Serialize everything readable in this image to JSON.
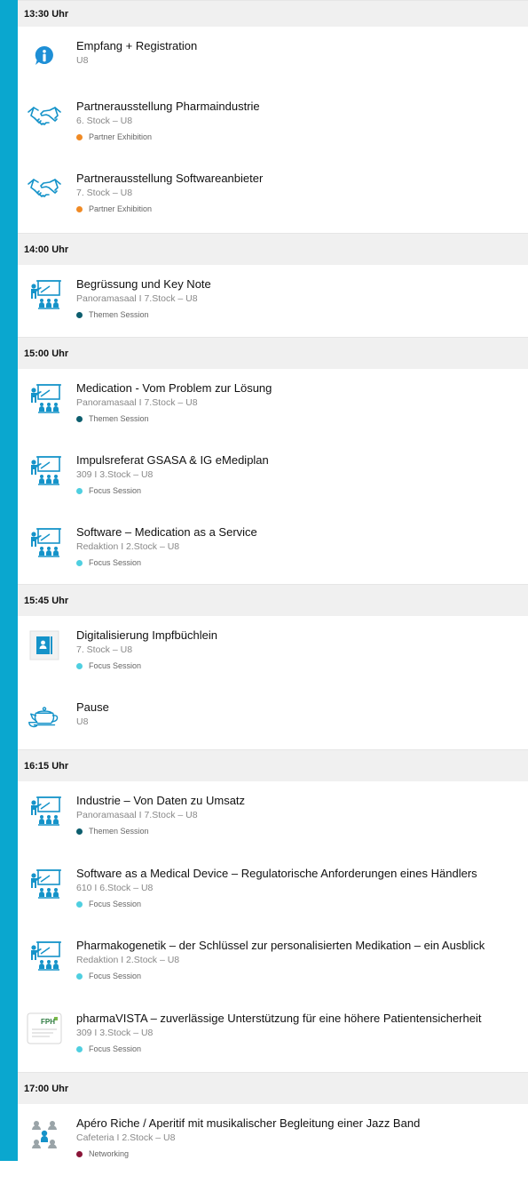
{
  "colors": {
    "sidebar": "#0aa7cf",
    "partner_exhibition": "#f08a24",
    "themen_session": "#0d5e6e",
    "focus_session": "#4fcfe0",
    "networking": "#8a1538"
  },
  "blocks": [
    {
      "time": "13:30 Uhr",
      "sessions": [
        {
          "icon": "info-icon",
          "title": "Empfang + Registration",
          "location": "U8",
          "tag": ""
        },
        {
          "icon": "handshake-icon",
          "title": "Partnerausstellung Pharmaindustrie",
          "location": "6. Stock – U8",
          "tag": "Partner Exhibition"
        },
        {
          "icon": "handshake-icon",
          "title": "Partnerausstellung Softwareanbieter",
          "location": "7. Stock – U8",
          "tag": "Partner Exhibition"
        }
      ]
    },
    {
      "time": "14:00 Uhr",
      "sessions": [
        {
          "icon": "presentation-icon",
          "title": "Begrüssung und Key Note",
          "location": "Panoramasaal I 7.Stock – U8",
          "tag": "Themen Session"
        }
      ]
    },
    {
      "time": "15:00 Uhr",
      "sessions": [
        {
          "icon": "presentation-icon",
          "title": "Medication - Vom Problem zur Lösung",
          "location": "Panoramasaal I 7.Stock – U8",
          "tag": "Themen Session"
        },
        {
          "icon": "presentation-icon",
          "title": "Impulsreferat GSASA & IG eMediplan",
          "location": "309 I 3.Stock – U8",
          "tag": "Focus Session"
        },
        {
          "icon": "presentation-icon",
          "title": "Software – Medication as a Service",
          "location": "Redaktion I 2.Stock – U8",
          "tag": "Focus Session"
        }
      ]
    },
    {
      "time": "15:45 Uhr",
      "sessions": [
        {
          "icon": "contact-book-icon",
          "title": "Digitalisierung Impfbüchlein",
          "location": "7. Stock – U8",
          "tag": "Focus Session"
        },
        {
          "icon": "teapot-icon",
          "title": "Pause",
          "location": "U8",
          "tag": ""
        }
      ]
    },
    {
      "time": "16:15 Uhr",
      "sessions": [
        {
          "icon": "presentation-icon",
          "title": "Industrie – Von Daten zu Umsatz",
          "location": "Panoramasaal I 7.Stock – U8",
          "tag": "Themen Session"
        },
        {
          "icon": "presentation-icon",
          "title": "Software as a Medical Device – Regulatorische Anforderungen eines Händlers",
          "location": "610 I 6.Stock – U8",
          "tag": "Focus Session"
        },
        {
          "icon": "presentation-icon",
          "title": "Pharmakogenetik – der Schlüssel zur personalisierten Medikation – ein Ausblick",
          "location": "Redaktion I 2.Stock – U8",
          "tag": "Focus Session"
        },
        {
          "icon": "fph-logo-icon",
          "title": "pharmaVISTA – zuverlässige Unterstützung für eine höhere Patientensicherheit",
          "location": "309 I 3.Stock – U8",
          "tag": "Focus Session",
          "logo_text": "FPH"
        }
      ]
    },
    {
      "time": "17:00 Uhr",
      "sessions": [
        {
          "icon": "networking-icon",
          "title": "Apéro Riche / Aperitif mit musikalischer Begleitung einer Jazz Band",
          "location": "Cafeteria I 2.Stock – U8",
          "tag": "Networking"
        }
      ]
    }
  ]
}
